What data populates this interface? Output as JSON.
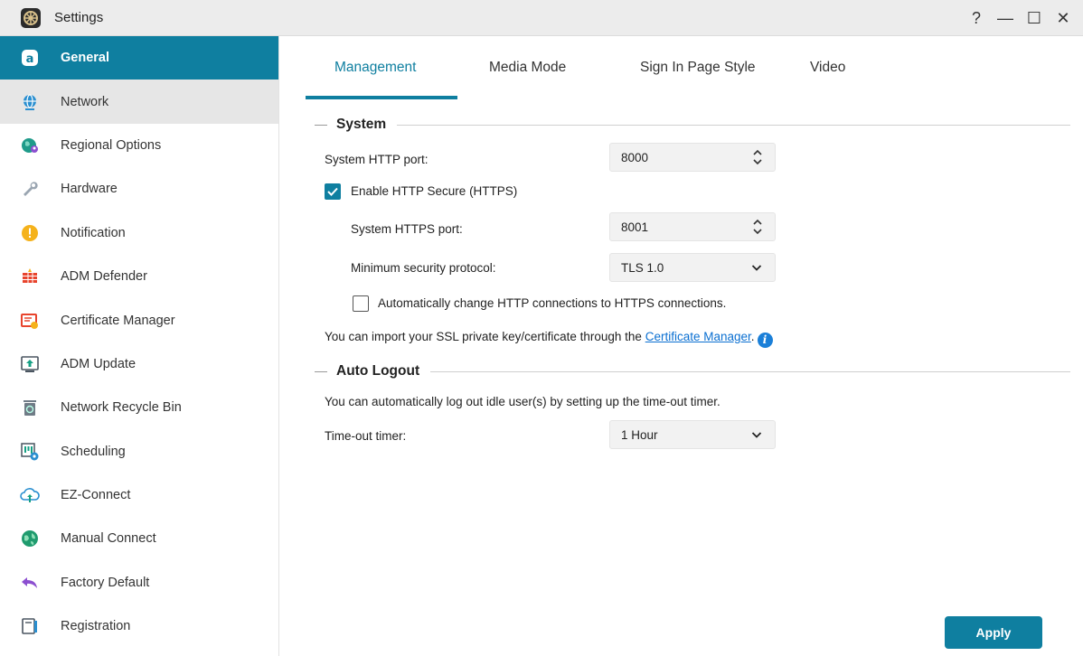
{
  "window": {
    "title": "Settings",
    "controls": {
      "help": "?",
      "minimize": "—",
      "maximize": "☐",
      "close": "✕"
    }
  },
  "sidebar": {
    "items": [
      {
        "label": "General",
        "icon": "general-icon",
        "state": "active"
      },
      {
        "label": "Network",
        "icon": "globe-icon",
        "state": "hover"
      },
      {
        "label": "Regional Options",
        "icon": "regional-globe-icon",
        "state": ""
      },
      {
        "label": "Hardware",
        "icon": "wrench-icon",
        "state": ""
      },
      {
        "label": "Notification",
        "icon": "exclamation-icon",
        "state": ""
      },
      {
        "label": "ADM Defender",
        "icon": "firewall-icon",
        "state": ""
      },
      {
        "label": "Certificate Manager",
        "icon": "certificate-icon",
        "state": ""
      },
      {
        "label": "ADM Update",
        "icon": "update-icon",
        "state": ""
      },
      {
        "label": "Network Recycle Bin",
        "icon": "recycle-bin-icon",
        "state": ""
      },
      {
        "label": "Scheduling",
        "icon": "calendar-gear-icon",
        "state": ""
      },
      {
        "label": "EZ-Connect",
        "icon": "cloud-upload-icon",
        "state": ""
      },
      {
        "label": "Manual Connect",
        "icon": "network-globe-icon",
        "state": ""
      },
      {
        "label": "Factory Default",
        "icon": "undo-arrow-icon",
        "state": ""
      },
      {
        "label": "Registration",
        "icon": "registration-icon",
        "state": ""
      }
    ]
  },
  "tabs": [
    {
      "label": "Management",
      "active": true
    },
    {
      "label": "Media Mode",
      "active": false
    },
    {
      "label": "Sign In Page Style",
      "active": false
    },
    {
      "label": "Video",
      "active": false
    }
  ],
  "system": {
    "heading": "System",
    "http_port_label": "System HTTP port:",
    "http_port_value": "8000",
    "enable_https_label": "Enable HTTP Secure (HTTPS)",
    "enable_https_checked": true,
    "https_port_label": "System HTTPS port:",
    "https_port_value": "8001",
    "min_protocol_label": "Minimum security protocol:",
    "min_protocol_value": "TLS 1.0",
    "auto_redirect_label": "Automatically change HTTP connections to HTTPS connections.",
    "auto_redirect_checked": false,
    "ssl_note_prefix": "You can import your SSL private key/certificate through the ",
    "ssl_note_link": "Certificate Manager",
    "ssl_note_suffix": ".",
    "info_glyph": "i"
  },
  "auto_logout": {
    "heading": "Auto Logout",
    "description": "You can automatically log out idle user(s) by setting up the time-out timer.",
    "timer_label": "Time-out timer:",
    "timer_value": "1 Hour"
  },
  "actions": {
    "apply_label": "Apply"
  },
  "colors": {
    "accent": "#0f7fa0",
    "link": "#0a6fd1",
    "sidebar_hover": "#e6e6e6"
  }
}
